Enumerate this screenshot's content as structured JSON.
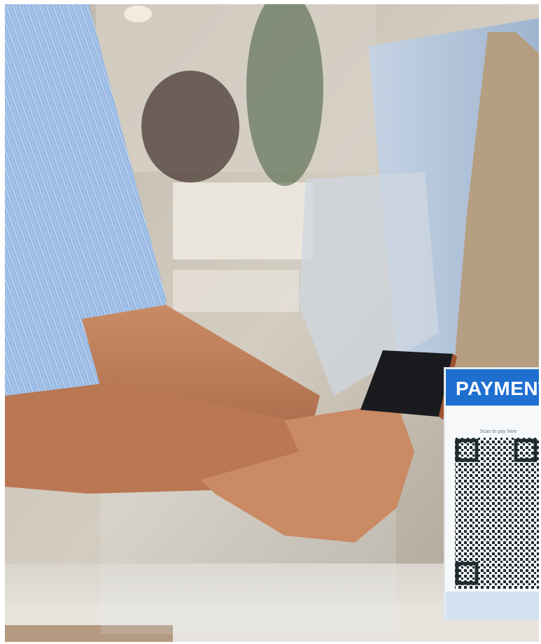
{
  "photo": {
    "subject": "QR code payment at a cafe counter",
    "sign_header": "PAYMENT",
    "sign_caption": "Scan to pay here",
    "colors": {
      "sign_blue": "#1f6fd1",
      "shirt_blue": "#8fb3e0",
      "apron_tan": "#b79a78",
      "counter_white": "#e7e3dd"
    }
  }
}
